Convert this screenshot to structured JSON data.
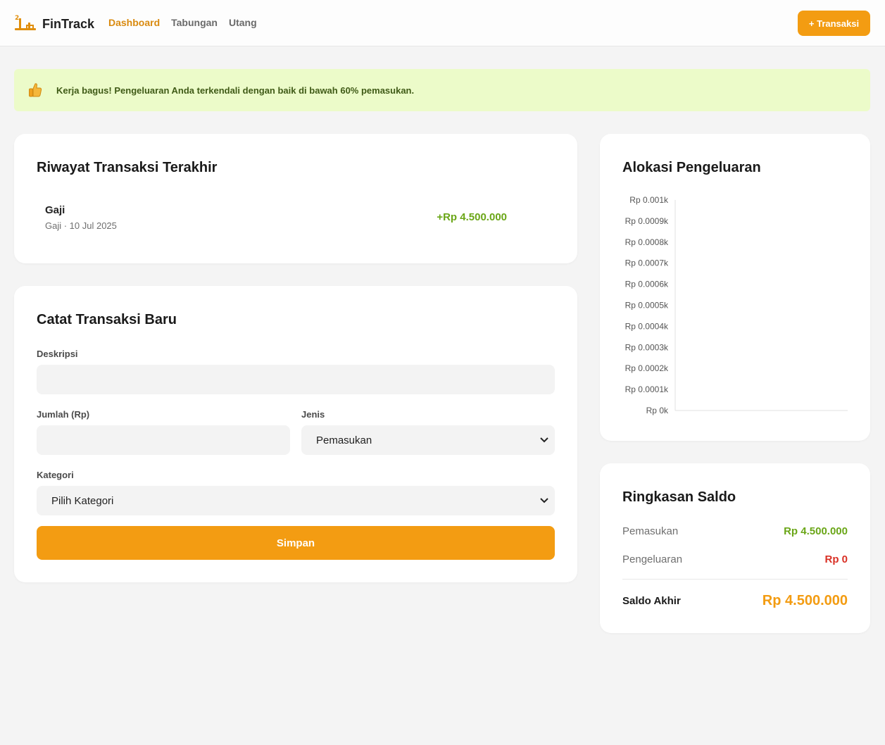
{
  "app": {
    "name": "FinTrack"
  },
  "nav": {
    "links": [
      "Dashboard",
      "Tabungan",
      "Utang"
    ],
    "active": "Dashboard",
    "add_transaction_label": "+ Transaksi"
  },
  "alert": {
    "message": "Kerja bagus! Pengeluaran Anda terkendali dengan baik di bawah 60% pemasukan."
  },
  "history": {
    "title": "Riwayat Transaksi Terakhir",
    "items": [
      {
        "name": "Gaji",
        "meta": "Gaji · 10 Jul 2025",
        "amount": "+Rp 4.500.000"
      }
    ]
  },
  "form": {
    "title": "Catat Transaksi Baru",
    "description_label": "Deskripsi",
    "description_value": "",
    "amount_label": "Jumlah (Rp)",
    "amount_value": "",
    "type_label": "Jenis",
    "type_value": "Pemasukan",
    "category_label": "Kategori",
    "category_value": "Pilih Kategori",
    "save_label": "Simpan"
  },
  "chart_section": {
    "title": "Alokasi Pengeluaran"
  },
  "chart_data": {
    "type": "bar",
    "title": "",
    "categories": [],
    "series": [],
    "ylim": [
      0,
      0.001
    ],
    "ytick_labels": [
      "Rp 0.001k",
      "Rp 0.0009k",
      "Rp 0.0008k",
      "Rp 0.0007k",
      "Rp 0.0006k",
      "Rp 0.0005k",
      "Rp 0.0004k",
      "Rp 0.0003k",
      "Rp 0.0002k",
      "Rp 0.0001k",
      "Rp 0k"
    ],
    "grid": false
  },
  "summary": {
    "title": "Ringkasan Saldo",
    "income_label": "Pemasukan",
    "income_value": "Rp 4.500.000",
    "expense_label": "Pengeluaran",
    "expense_value": "Rp 0",
    "final_label": "Saldo Akhir",
    "final_value": "Rp 4.500.000"
  },
  "colors": {
    "accent": "#f39c12",
    "income": "#6aa617",
    "expense": "#d93025",
    "alert_bg": "#ecfbc9"
  },
  "icons": {
    "logo": "scale-logo-icon",
    "alert": "thumbs-up-icon",
    "select": "chevron-down-icon"
  }
}
